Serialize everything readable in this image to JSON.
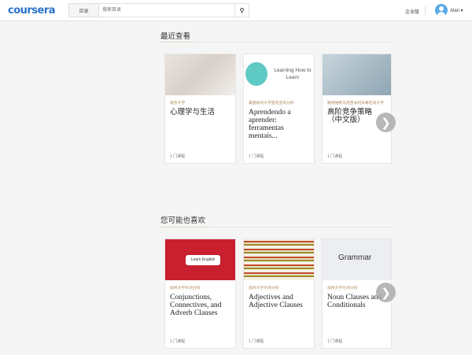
{
  "header": {
    "logo": "coursera",
    "catalog_label": "目录",
    "search_placeholder": "搜索目录",
    "enterprise_label": "企业版",
    "user_name": "Alan ▾"
  },
  "recent": {
    "title": "最近查看",
    "cards": [
      {
        "partner": "南京大学",
        "title": "心理学与生活",
        "count": "1 门课程"
      },
      {
        "partner": "美国加州大学圣地亚哥分校",
        "title": "Aprendendo a aprender: ferramentas mentais...",
        "count": "1 门课程",
        "image_text": "Learning How to Learn"
      },
      {
        "partner": "路德维希马克西米利安慕尼黑大学",
        "title": "高阶竞争策略（中文版）",
        "count": "1 门课程"
      }
    ]
  },
  "recommended": {
    "title": "您可能也喜欢",
    "cards": [
      {
        "partner": "加州大学尔湾分校",
        "title": "Conjunctions, Connectives, and Adverb Clauses",
        "count": "1 门课程",
        "image_text": "Learn English"
      },
      {
        "partner": "加州大学尔湾分校",
        "title": "Adjectives and Adjective Clauses",
        "count": "1 门课程"
      },
      {
        "partner": "加州大学尔湾分校",
        "title": "Noun Clauses and Conditionals",
        "count": "1 门课程",
        "image_text": "Grammar"
      }
    ]
  },
  "icons": {
    "search": "search-icon",
    "next": "chevron-right-icon",
    "avatar": "user-avatar-icon"
  }
}
